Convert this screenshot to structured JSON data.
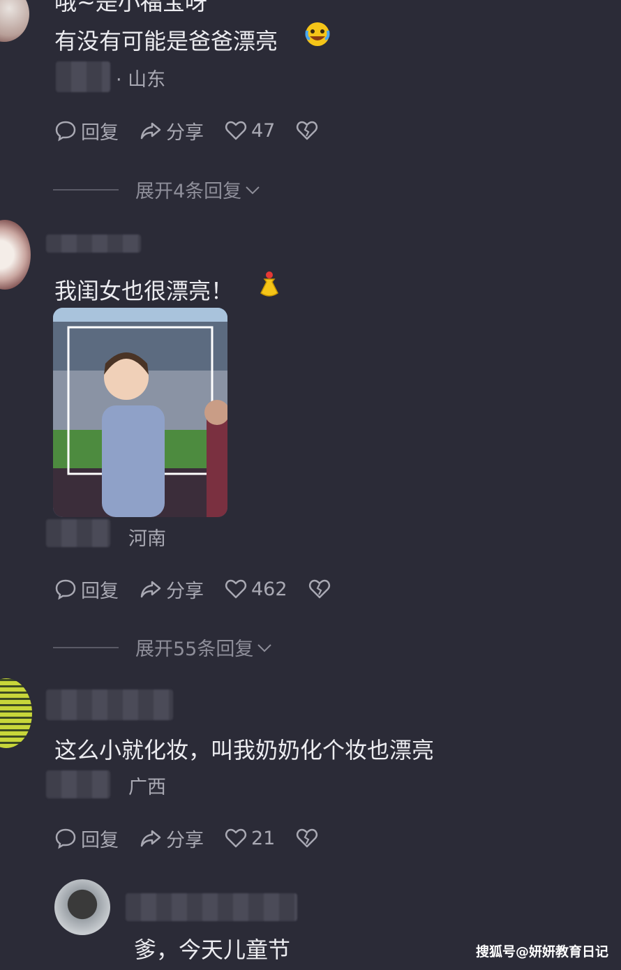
{
  "comments": [
    {
      "text_partial_top": "哦~是小福宝呀",
      "text": "有没有可能是爸爸漂亮",
      "location": "· 山东",
      "reply_label": "回复",
      "share_label": "分享",
      "likes": "47",
      "expand_label": "展开4条回复"
    },
    {
      "text": "我闺女也很漂亮！",
      "location": "河南",
      "reply_label": "回复",
      "share_label": "分享",
      "likes": "462",
      "expand_label": "展开55条回复"
    },
    {
      "text": "这么小就化妆，叫我奶奶化个妆也漂亮",
      "location": "广西",
      "reply_label": "回复",
      "share_label": "分享",
      "likes": "21"
    },
    {
      "text": "爹，今天儿童节"
    }
  ],
  "watermark": "搜狐号@妍妍教育日记",
  "colors": {
    "background": "#2b2b37",
    "text": "#ececf0",
    "muted": "#a9a9b3",
    "emoji_yellow": "#f5c518"
  },
  "icons": [
    "reply-icon",
    "share-icon",
    "heart-icon",
    "broken-heart-icon",
    "chevron-down-icon"
  ]
}
